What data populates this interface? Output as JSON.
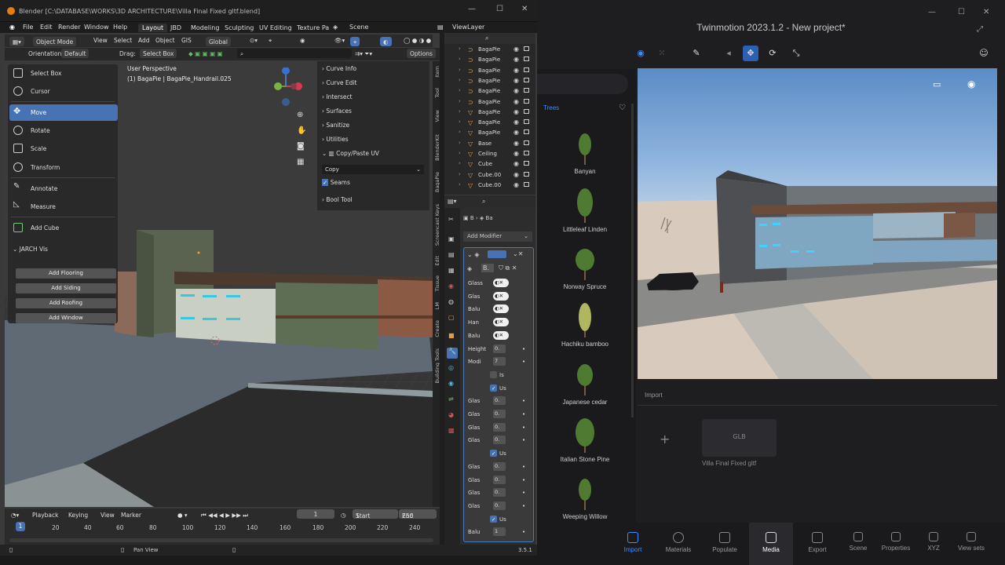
{
  "blender": {
    "title": "Blender [C:\\DATABASE\\WORKS\\3D ARCHITECTURE\\Villa Final Fixed gltf.blend]",
    "menu": [
      "File",
      "Edit",
      "Render",
      "Window",
      "Help"
    ],
    "workspaces": [
      "Layout",
      "JBD",
      "Modeling",
      "Sculpting",
      "UV Editing",
      "Texture Pa"
    ],
    "scene": "Scene",
    "view_layer": "ViewLayer",
    "header": {
      "mode": "Object Mode",
      "view": "View",
      "select": "Select",
      "add": "Add",
      "object": "Object",
      "gis": "GIS",
      "transform": "Global"
    },
    "header2": {
      "orientation_label": "Orientation:",
      "orientation": "Default",
      "drag_label": "Drag:",
      "drag": "Select Box",
      "options": "Options"
    },
    "viewport": {
      "line1": "User Perspective",
      "line2": "(1) BagaPie | BagaPie_Handrail.025"
    },
    "tools": [
      "Select Box",
      "Cursor",
      "Move",
      "Rotate",
      "Scale",
      "Transform",
      "Annotate",
      "Measure",
      "Add Cube"
    ],
    "jarch": {
      "title": "JARCH Vis",
      "buttons": [
        "Add Flooring",
        "Add Siding",
        "Add Roofing",
        "Add Window"
      ]
    },
    "npanel": {
      "items": [
        "Curve Info",
        "Curve Edit",
        "Intersect",
        "Surfaces",
        "Sanitize",
        "Utilities",
        "Copy/Paste UV"
      ],
      "copy": "Copy",
      "seams": "Seams",
      "bool": "Bool Tool"
    },
    "vtabs": [
      "Item",
      "Tool",
      "View",
      "BlenderKit",
      "BagaPie",
      "Screencast Keys",
      "Edit",
      "Tissue",
      "LM",
      "Create",
      "Building Tools"
    ],
    "outliner": [
      "BagaPie",
      "BagaPie",
      "BagaPie",
      "BagaPie",
      "BagaPie",
      "BagaPie",
      "BagaPie",
      "BagaPie",
      "BagaPie",
      "Base",
      "Ceiling",
      "Cube",
      "Cube.00",
      "Cube.00"
    ],
    "props": {
      "crumb1": "B",
      "crumb2": "Ba",
      "add_modifier": "Add Modifier",
      "mod_name": "B.",
      "rows": [
        [
          "Glass",
          ""
        ],
        [
          "Glas",
          ""
        ],
        [
          "Balu",
          ""
        ],
        [
          "Han",
          ""
        ],
        [
          "Balu",
          ""
        ],
        [
          "Height",
          "0."
        ],
        [
          "Modi",
          "7"
        ],
        [
          "",
          "Is"
        ],
        [
          "",
          "Us"
        ],
        [
          "Glas",
          "0."
        ],
        [
          "Glas",
          "0."
        ],
        [
          "Glas",
          "0."
        ],
        [
          "Glas",
          "0."
        ],
        [
          "",
          "Us"
        ],
        [
          "Glas",
          "0."
        ],
        [
          "Glas",
          "0."
        ],
        [
          "Glas",
          "0."
        ],
        [
          "Glas",
          "0."
        ],
        [
          "",
          "Us"
        ],
        [
          "Balu",
          "1"
        ]
      ]
    },
    "timeline": {
      "playback": "Playback",
      "keying": "Keying",
      "view": "View",
      "marker": "Marker",
      "frame": "1",
      "start_label": "Start",
      "start": "1",
      "end_label": "End",
      "end": "250",
      "ticks": [
        "1",
        "20",
        "40",
        "60",
        "80",
        "100",
        "120",
        "140",
        "160",
        "180",
        "200",
        "220",
        "240"
      ]
    },
    "status": {
      "pan": "Pan View",
      "version": "3.5.1"
    }
  },
  "twinmotion": {
    "title": "Twinmotion 2023.1.2 - New project*",
    "category": "Trees",
    "trees": [
      "Banyan",
      "Littleleaf Linden",
      "Norway Spruce",
      "Hachiku bamboo",
      "Japanese cedar",
      "Italian Stone Pine",
      "Weeping Willow"
    ],
    "import_label": "Import",
    "glb_badge": "GLB",
    "glb_name": "Villa Final Fixed gltf",
    "bottom": [
      "Import",
      "Materials",
      "Populate",
      "Media",
      "Export",
      "Scene",
      "Properties",
      "XYZ",
      "View sets"
    ]
  },
  "colors": {
    "blender_accent": "#4772b3",
    "twinmotion_accent": "#3d8bff"
  }
}
